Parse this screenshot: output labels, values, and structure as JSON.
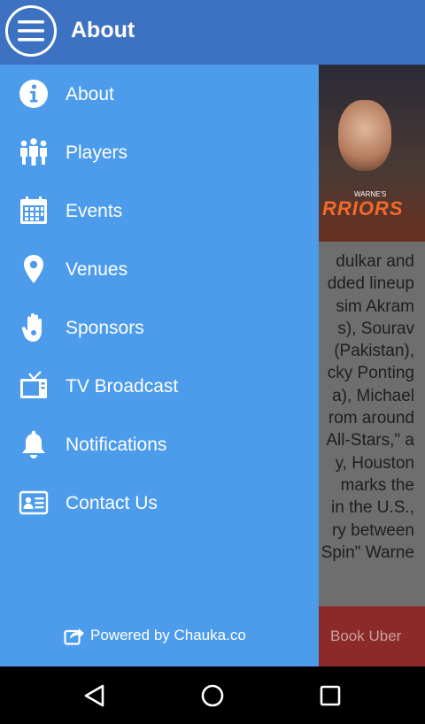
{
  "appbar": {
    "title": "About"
  },
  "drawer": {
    "items": [
      {
        "label": "About",
        "icon": "info-icon"
      },
      {
        "label": "Players",
        "icon": "players-icon"
      },
      {
        "label": "Events",
        "icon": "calendar-icon"
      },
      {
        "label": "Venues",
        "icon": "location-pin-icon"
      },
      {
        "label": "Sponsors",
        "icon": "hand-icon"
      },
      {
        "label": "TV Broadcast",
        "icon": "tv-icon"
      },
      {
        "label": "Notifications",
        "icon": "bell-icon"
      },
      {
        "label": "Contact Us",
        "icon": "contact-card-icon"
      }
    ],
    "footer": "Powered by Chauka.co"
  },
  "content": {
    "hero_text": "RRIORS",
    "hero_badge": "WARNE'S",
    "article_lines": [
      "dulkar and",
      "dded lineup",
      "sim Akram",
      "s), Sourav",
      "(Pakistan),",
      "cky Ponting",
      "a), Michael",
      "rom around",
      "All-Stars,\" a",
      "y, Houston",
      "marks the",
      "in the U.S.,",
      "ry between",
      "Spin\" Warne"
    ],
    "uber_label": "Book Uber"
  },
  "colors": {
    "appbar": "#3d72c2",
    "drawer": "#4c9ceb",
    "uber": "#8c2a2a"
  }
}
